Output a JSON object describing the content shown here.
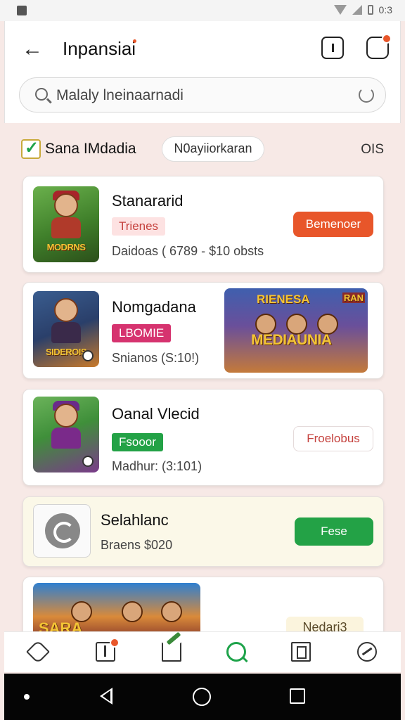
{
  "status_bar": {
    "time": "0:3"
  },
  "header": {
    "title": "Inpansiai",
    "search_placeholder": "Malaly lneinaarnadi"
  },
  "filter": {
    "checkbox_label": "Sana IMdadia",
    "chip_label": "N0ayiiorkaran",
    "right_label": "OIS"
  },
  "cards": [
    {
      "title": "Stanararid",
      "tag": "Trienes",
      "meta": "Daidoas ( 6789 - $10 obsts",
      "button": "Bemenoer",
      "thumb_text": "MODRNS"
    },
    {
      "title": "Nomgadana",
      "tag": "LBOMIE",
      "meta": "Snianos (S:10!)",
      "thumb_text": "SIDEROIS",
      "banner_top": "RIENESA",
      "banner_corner": "RAN",
      "banner_main": "MEDIAUNIA"
    },
    {
      "title": "Oanal Vlecid",
      "tag": "Fsooor",
      "meta": "Madhur: (3:101)",
      "button": "Froelobus"
    },
    {
      "title": "Selahlanc",
      "meta": "Braens $020",
      "button": "Fese"
    },
    {
      "promo_text": "SARA",
      "promo_tag": "Nedari3"
    }
  ],
  "colors": {
    "accent_orange": "#e8562a",
    "accent_green": "#23a246",
    "accent_magenta": "#d6336f",
    "background": "#f7e9e6"
  }
}
